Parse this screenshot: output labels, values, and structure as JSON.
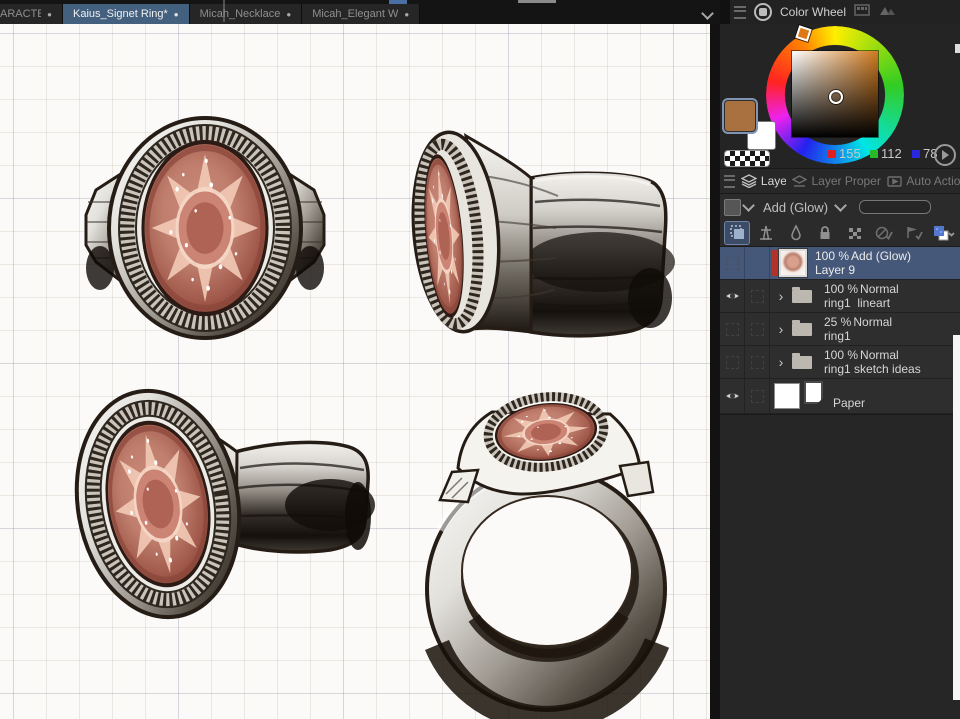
{
  "doc_tabbar": {
    "tabs": [
      {
        "label": "ARACTER AC"
      },
      {
        "label": "Kaius_Signet Ring*"
      },
      {
        "label": "Micah_Necklace"
      },
      {
        "label": "Micah_Elegant W"
      }
    ],
    "unsaved_dot": "●"
  },
  "color_panel": {
    "title": "Color Wheel",
    "rgb": {
      "r": "155",
      "g": "112",
      "b": "78"
    },
    "foreground_color": "#a9713f",
    "background_color": "#ffffff",
    "selected_hue_color": "#e07818"
  },
  "layer_panel": {
    "tabs": {
      "layer": "Layer",
      "layer_property": "Layer Property",
      "auto_action": "Auto Action"
    },
    "blend_mode_selected": "Add (Glow)",
    "selected_row_color": "#46587a",
    "layers": [
      {
        "opacity": "100 %",
        "mode": "Add (Glow)",
        "name": "Layer 9"
      },
      {
        "opacity": "100 %",
        "mode": "Normal",
        "name": "ring1  lineart"
      },
      {
        "opacity": "25 %",
        "mode": "Normal",
        "name": "ring1"
      },
      {
        "opacity": "100 %",
        "mode": "Normal",
        "name": "ring1 sketch ideas"
      },
      {
        "name": "Paper"
      }
    ]
  }
}
